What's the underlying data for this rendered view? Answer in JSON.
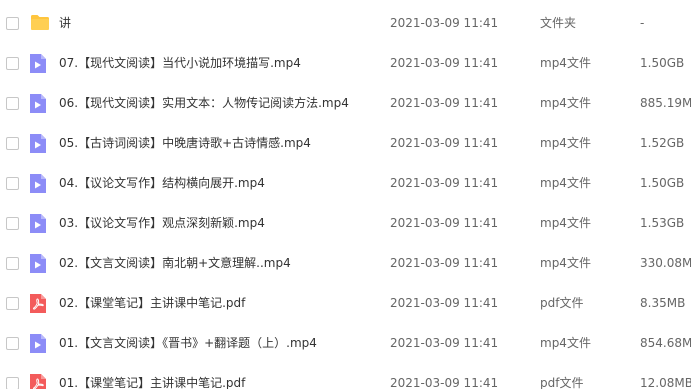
{
  "files": [
    {
      "name": "讲",
      "date": "2021-03-09 11:41",
      "type": "文件夹",
      "size": "-",
      "icon": "folder-icon"
    },
    {
      "name": "07.【现代文阅读】当代小说加环境描写.mp4",
      "date": "2021-03-09 11:41",
      "type": "mp4文件",
      "size": "1.50GB",
      "icon": "video-file-icon"
    },
    {
      "name": "06.【现代文阅读】实用文本：人物传记阅读方法.mp4",
      "date": "2021-03-09 11:41",
      "type": "mp4文件",
      "size": "885.19M",
      "icon": "video-file-icon"
    },
    {
      "name": "05.【古诗词阅读】中晚唐诗歌+古诗情感.mp4",
      "date": "2021-03-09 11:41",
      "type": "mp4文件",
      "size": "1.52GB",
      "icon": "video-file-icon"
    },
    {
      "name": "04.【议论文写作】结构横向展开.mp4",
      "date": "2021-03-09 11:41",
      "type": "mp4文件",
      "size": "1.50GB",
      "icon": "video-file-icon"
    },
    {
      "name": "03.【议论文写作】观点深刻新颖.mp4",
      "date": "2021-03-09 11:41",
      "type": "mp4文件",
      "size": "1.53GB",
      "icon": "video-file-icon"
    },
    {
      "name": "02.【文言文阅读】南北朝+文意理解..mp4",
      "date": "2021-03-09 11:41",
      "type": "mp4文件",
      "size": "330.08M",
      "icon": "video-file-icon"
    },
    {
      "name": "02.【课堂笔记】主讲课中笔记.pdf",
      "date": "2021-03-09 11:41",
      "type": "pdf文件",
      "size": "8.35MB",
      "icon": "pdf-file-icon"
    },
    {
      "name": "01.【文言文阅读】《晋书》+翻译题（上）.mp4",
      "date": "2021-03-09 11:41",
      "type": "mp4文件",
      "size": "854.68M",
      "icon": "video-file-icon"
    },
    {
      "name": "01.【课堂笔记】主讲课中笔记.pdf",
      "date": "2021-03-09 11:41",
      "type": "pdf文件",
      "size": "12.08MB",
      "icon": "pdf-file-icon"
    }
  ],
  "colors": {
    "folder": "#ffc53d",
    "video": "#8c8cf7",
    "pdf": "#f35b5b"
  }
}
